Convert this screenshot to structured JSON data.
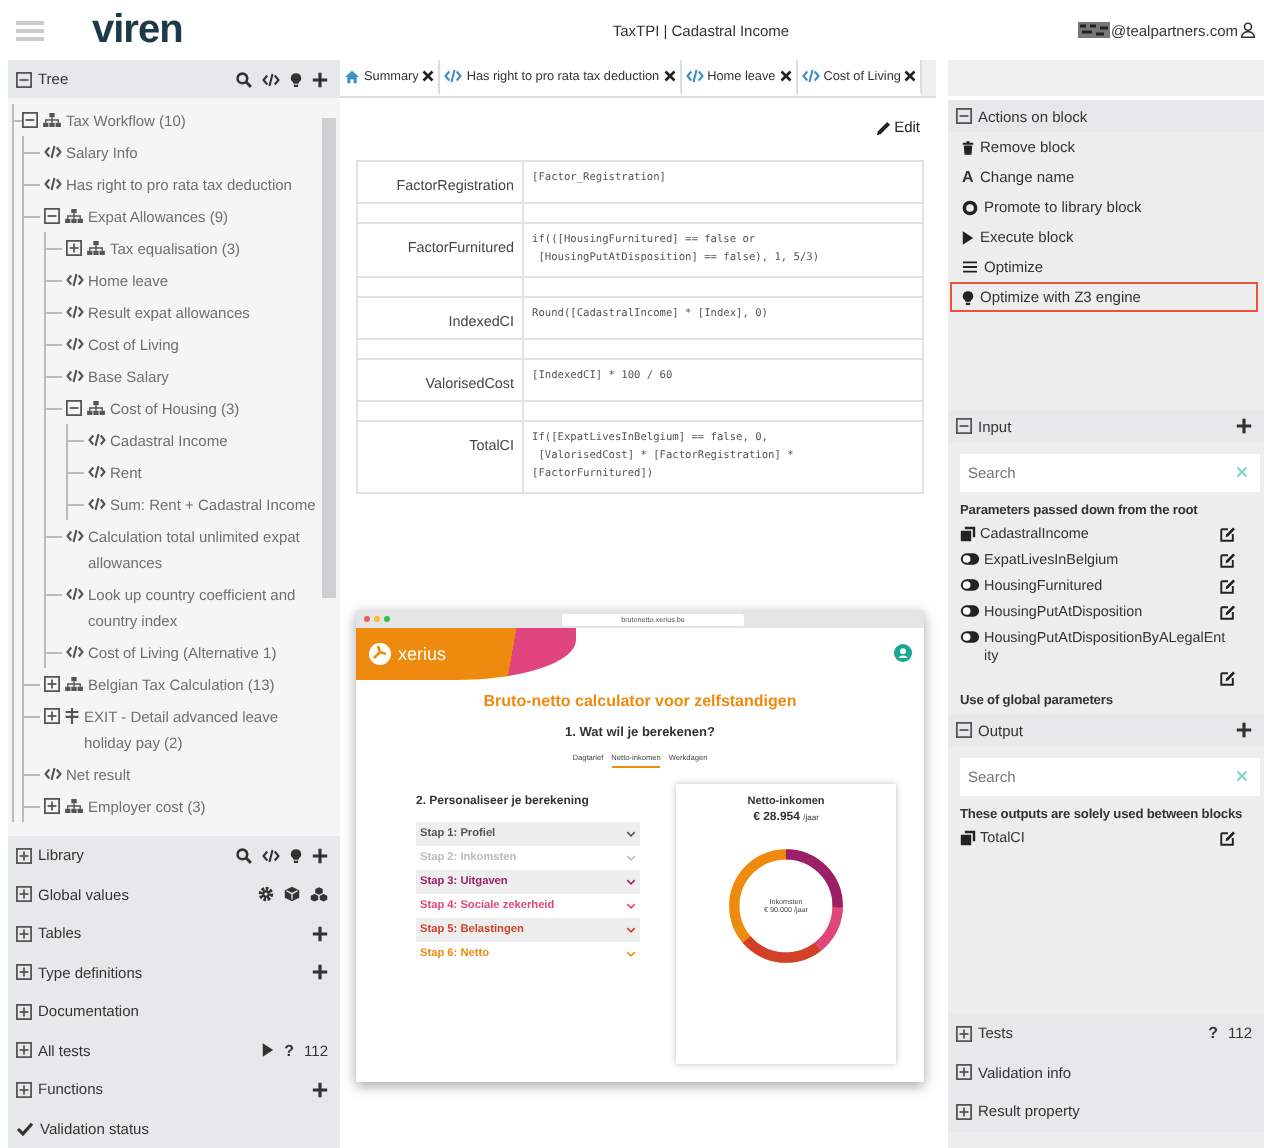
{
  "header": {
    "logo": "viren",
    "title": "TaxTPI | Cadastral Income",
    "user_email": "@tealpartners.com"
  },
  "tree": {
    "title": "Tree",
    "expanded": true,
    "items": [
      {
        "label": "Tax Workflow (10)",
        "kind": "group",
        "expanded": true,
        "children": [
          {
            "label": "Salary Info",
            "kind": "block"
          },
          {
            "label": "Has right to pro rata tax deduction",
            "kind": "block"
          },
          {
            "label": "Expat Allowances (9)",
            "kind": "group",
            "expanded": true,
            "children": [
              {
                "label": "Tax equalisation (3)",
                "kind": "group",
                "expanded": false
              },
              {
                "label": "Home leave",
                "kind": "block"
              },
              {
                "label": "Result expat allowances",
                "kind": "block"
              },
              {
                "label": "Cost of Living",
                "kind": "block"
              },
              {
                "label": "Base Salary",
                "kind": "block"
              },
              {
                "label": "Cost of Housing (3)",
                "kind": "group",
                "expanded": true,
                "children": [
                  {
                    "label": "Cadastral Income",
                    "kind": "block"
                  },
                  {
                    "label": "Rent",
                    "kind": "block"
                  },
                  {
                    "label": "Sum: Rent + Cadastral Income",
                    "kind": "block"
                  }
                ]
              },
              {
                "label": "Calculation total unlimited expat allowances",
                "kind": "block"
              },
              {
                "label": "Look up country coefficient and country index",
                "kind": "block"
              },
              {
                "label": "Cost of Living (Alternative 1)",
                "kind": "block"
              }
            ]
          },
          {
            "label": "Belgian Tax Calculation (13)",
            "kind": "group",
            "expanded": false
          },
          {
            "label": "EXIT - Detail advanced leave holiday pay (2)",
            "kind": "exit",
            "expanded": false
          },
          {
            "label": "Net result",
            "kind": "block"
          },
          {
            "label": "Employer cost (3)",
            "kind": "group",
            "expanded": false
          }
        ]
      }
    ]
  },
  "left_sections": [
    {
      "title": "Library",
      "kind": "library",
      "expanded": false
    },
    {
      "title": "Global values",
      "kind": "globals",
      "expanded": false
    },
    {
      "title": "Tables",
      "kind": "addable",
      "expanded": false
    },
    {
      "title": "Type definitions",
      "kind": "addable",
      "expanded": false
    },
    {
      "title": "Documentation",
      "kind": "plain",
      "expanded": false
    },
    {
      "title": "All tests",
      "kind": "tests",
      "expanded": false,
      "help": "?",
      "count": "112"
    },
    {
      "title": "Functions",
      "kind": "addable",
      "expanded": false
    },
    {
      "title": "Validation status",
      "kind": "status"
    }
  ],
  "tabs": [
    {
      "label": "Summary",
      "kind": "summary",
      "selected": false
    },
    {
      "label": "Has right to pro rata tax deduction",
      "kind": "block",
      "selected": false
    },
    {
      "label": "Home leave",
      "kind": "block",
      "selected": false
    },
    {
      "label": "Cost of Living",
      "kind": "block",
      "selected": false
    }
  ],
  "editor": {
    "edit_label": "Edit",
    "rows": [
      {
        "name": "FactorRegistration",
        "formula": "[Factor_Registration]"
      },
      {
        "name": "FactorFurnitured",
        "formula": "if(([HousingFurnitured] == false or\n [HousingPutAtDisposition] == false), 1, 5/3)"
      },
      {
        "name": "IndexedCI",
        "formula": "Round([CadastralIncome] * [Index], 0)"
      },
      {
        "name": "ValorisedCost",
        "formula": "[IndexedCI] * 100 / 60"
      },
      {
        "name": "TotalCI",
        "formula": "If([ExpatLivesInBelgium] == false, 0,\n [ValorisedCost] * [FactorRegistration] * [FactorFurnitured])"
      }
    ]
  },
  "preview": {
    "url": "brutonetto.xerius.be",
    "brand": "xerius",
    "heading": "Bruto-netto calculator voor zelfstandigen",
    "question": "1. Wat wil je berekenen?",
    "modes": [
      {
        "label": "Dagtarief",
        "selected": false
      },
      {
        "label": "Netto-inkomen",
        "selected": true
      },
      {
        "label": "Werkdagen",
        "selected": false
      }
    ],
    "personalise": "2. Personaliseer je berekening",
    "steps": [
      {
        "label": "Stap 1: Profiel",
        "color": "#555555"
      },
      {
        "label": "Stap 2: Inkomsten",
        "color": "#bbbbbb"
      },
      {
        "label": "Stap 3: Uitgaven",
        "color": "#9c1f6a"
      },
      {
        "label": "Stap 4: Sociale zekerheid",
        "color": "#e0457e"
      },
      {
        "label": "Stap 5: Belastingen",
        "color": "#d2402a"
      },
      {
        "label": "Stap 6: Netto",
        "color": "#ee8a0e"
      }
    ],
    "result": {
      "title": "Netto-inkomen",
      "amount": "€ 28.954",
      "unit": "/jaar",
      "center_label": "Inkomsten",
      "center_value": "€ 90.000 /jaar"
    }
  },
  "actions": {
    "title": "Actions on block",
    "expanded": true,
    "items": [
      {
        "label": "Remove block",
        "kind": "remove",
        "highlighted": false
      },
      {
        "label": "Change name",
        "kind": "rename",
        "glyph": "A",
        "highlighted": false
      },
      {
        "label": "Promote to library block",
        "kind": "promote",
        "highlighted": false
      },
      {
        "label": "Execute block",
        "kind": "execute",
        "highlighted": false
      },
      {
        "label": "Optimize",
        "kind": "optimize",
        "highlighted": false
      },
      {
        "label": "Optimize with Z3 engine",
        "kind": "z3",
        "highlighted": true
      }
    ]
  },
  "input": {
    "title": "Input",
    "expanded": true,
    "search_placeholder": "Search",
    "heading": "Parameters passed down from the root",
    "params": [
      {
        "name": "CadastralIncome",
        "kind": "number"
      },
      {
        "name": "ExpatLivesInBelgium",
        "kind": "boolean"
      },
      {
        "name": "HousingFurnitured",
        "kind": "boolean"
      },
      {
        "name": "HousingPutAtDisposition",
        "kind": "boolean"
      },
      {
        "name": "HousingPutAtDispositionByALegalEntity",
        "kind": "boolean"
      }
    ],
    "next_heading": "Use of global parameters"
  },
  "output": {
    "title": "Output",
    "expanded": true,
    "search_placeholder": "Search",
    "heading": "These outputs are solely used between blocks",
    "params": [
      {
        "name": "TotalCI",
        "kind": "number"
      }
    ]
  },
  "right_sections": [
    {
      "title": "Tests",
      "kind": "tests",
      "expanded": false,
      "help": "?",
      "count": "112"
    },
    {
      "title": "Validation info",
      "kind": "plain",
      "expanded": false
    },
    {
      "title": "Result property",
      "kind": "plain",
      "expanded": false
    }
  ]
}
